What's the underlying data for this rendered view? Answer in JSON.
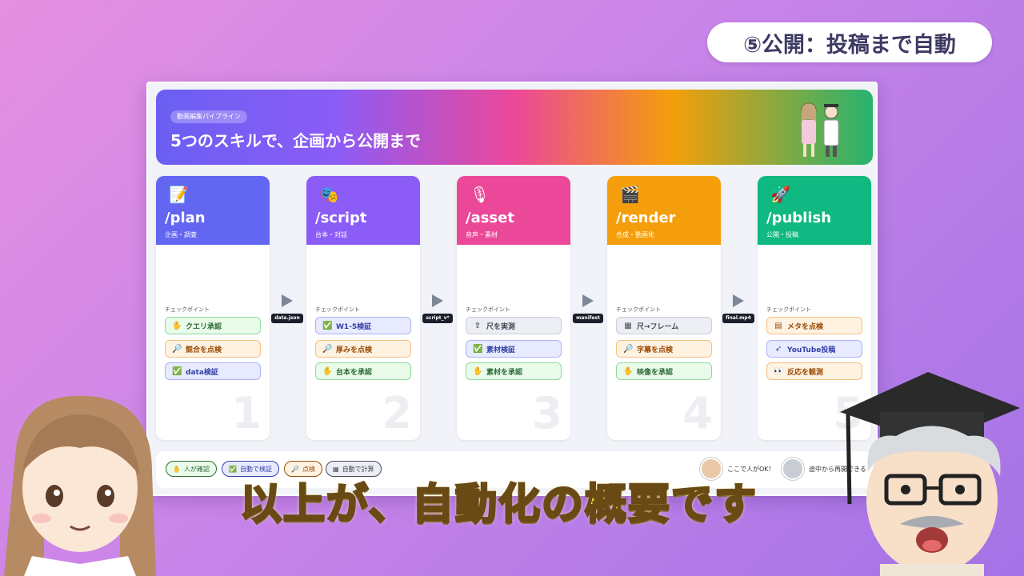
{
  "header": {
    "step_title": "⑤公開：投稿まで自動"
  },
  "banner": {
    "tag": "動画編集パイプライン",
    "title": "5つのスキルで、企画から公開まで"
  },
  "cards": [
    {
      "icon": "📝",
      "icon_name": "memo-icon",
      "cmd": "/plan",
      "sub": "企画・調査",
      "color": "#6366f1",
      "check_label": "チェックポイント",
      "number": "1",
      "chips": [
        {
          "icon": "✋",
          "text": "クエリ承認",
          "style": "green"
        },
        {
          "icon": "🔎",
          "text": "競合を点検",
          "style": "orange"
        },
        {
          "icon": "✅",
          "text": "data検証",
          "style": "blue"
        }
      ]
    },
    {
      "icon": "🎭",
      "icon_name": "theater-masks-icon",
      "cmd": "/script",
      "sub": "台本・対話",
      "color": "#8b5cf6",
      "check_label": "チェックポイント",
      "number": "2",
      "chips": [
        {
          "icon": "✅",
          "text": "W1-5検証",
          "style": "blue"
        },
        {
          "icon": "🔎",
          "text": "厚みを点検",
          "style": "orange"
        },
        {
          "icon": "✋",
          "text": "台本を承認",
          "style": "green"
        }
      ]
    },
    {
      "icon": "🎙",
      "icon_name": "microphone-icon",
      "cmd": "/asset",
      "sub": "音声・素材",
      "color": "#ec4899",
      "check_label": "チェックポイント",
      "number": "3",
      "chips": [
        {
          "icon": "⇧",
          "text": "尺を実測",
          "style": "gray"
        },
        {
          "icon": "✅",
          "text": "素材検証",
          "style": "blue"
        },
        {
          "icon": "✋",
          "text": "素材を承認",
          "style": "green"
        }
      ]
    },
    {
      "icon": "🎬",
      "icon_name": "clapperboard-icon",
      "cmd": "/render",
      "sub": "合成・動画化",
      "color": "#f59e0b",
      "check_label": "チェックポイント",
      "number": "4",
      "chips": [
        {
          "icon": "▦",
          "text": "尺→フレーム",
          "style": "gray"
        },
        {
          "icon": "🔎",
          "text": "字幕を点検",
          "style": "orange"
        },
        {
          "icon": "✋",
          "text": "映像を承認",
          "style": "green"
        }
      ]
    },
    {
      "icon": "🚀",
      "icon_name": "rocket-icon",
      "cmd": "/publish",
      "sub": "公開・投稿",
      "color": "#10b981",
      "check_label": "チェックポイント",
      "number": "5",
      "chips": [
        {
          "icon": "▤",
          "text": "メタを点検",
          "style": "orange"
        },
        {
          "icon": "➶",
          "text": "YouTube投稿",
          "style": "blue"
        },
        {
          "icon": "👀",
          "text": "反応を観測",
          "style": "orange"
        }
      ]
    }
  ],
  "arrows": [
    "data.json",
    "script_v*",
    "manifest",
    "final.mp4"
  ],
  "legend": {
    "chips": [
      {
        "icon": "✋",
        "text": "人が確認",
        "style": "green"
      },
      {
        "icon": "✅",
        "text": "自動で検証",
        "style": "blue"
      },
      {
        "icon": "🔎",
        "text": "点検",
        "style": "orange"
      },
      {
        "icon": "▦",
        "text": "自動で計算",
        "style": "gray"
      }
    ],
    "note1": "ここで人がOK！",
    "note2": "途中から再開できる"
  },
  "caption": "以上が、自動化の概要です"
}
